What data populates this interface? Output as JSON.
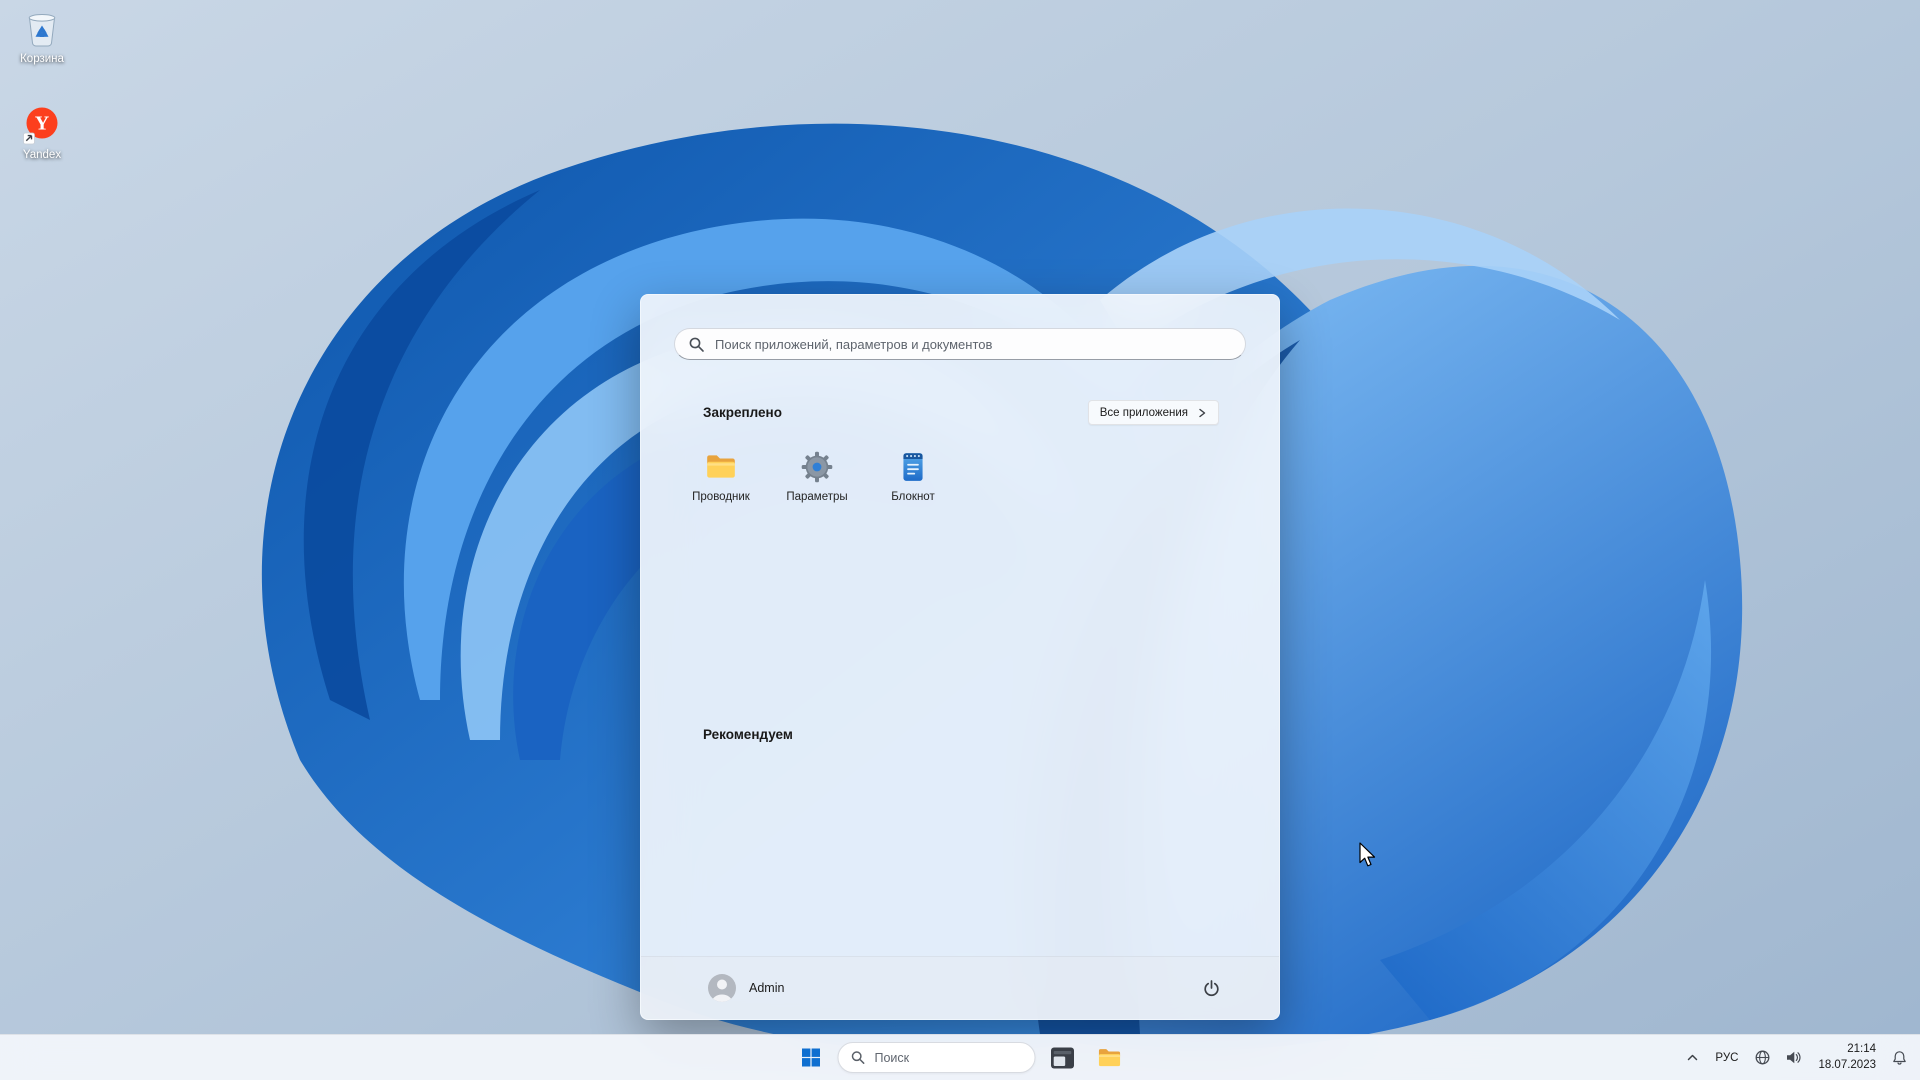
{
  "desktop": {
    "icons": [
      {
        "name": "recycle-bin",
        "label": "Корзина"
      },
      {
        "name": "yandex-browser",
        "label": "Yandex"
      }
    ]
  },
  "start_menu": {
    "search": {
      "placeholder": "Поиск приложений, параметров и документов",
      "icon": "search-icon"
    },
    "pinned": {
      "header": "Закреплено",
      "all_apps_button": "Все приложения",
      "apps": [
        {
          "label": "Проводник",
          "icon": "folder-icon"
        },
        {
          "label": "Параметры",
          "icon": "gear-icon"
        },
        {
          "label": "Блокнот",
          "icon": "notepad-icon"
        }
      ]
    },
    "recommended": {
      "header": "Рекомендуем"
    },
    "footer": {
      "user": "Admin",
      "power_icon": "power-icon"
    }
  },
  "taskbar": {
    "start_button_icon": "windows-logo-icon",
    "search": {
      "placeholder": "Поиск",
      "icon": "search-icon"
    },
    "pinned_apps": [
      {
        "name": "dark-app-window"
      },
      {
        "name": "file-explorer"
      }
    ],
    "tray": {
      "chevron_icon": "chevron-up-icon",
      "language": "РУС",
      "network_icon": "globe-icon",
      "volume_icon": "speaker-icon",
      "time": "21:14",
      "date": "18.07.2023",
      "notification_icon": "bell-icon"
    }
  },
  "colors": {
    "accent": "#0078d4",
    "wallpaper_light": "#c3d2e2",
    "wallpaper_blue": "#1c6ecf",
    "menu_bg": "#f3f6fb",
    "taskbar_bg": "#f2f6fb"
  }
}
